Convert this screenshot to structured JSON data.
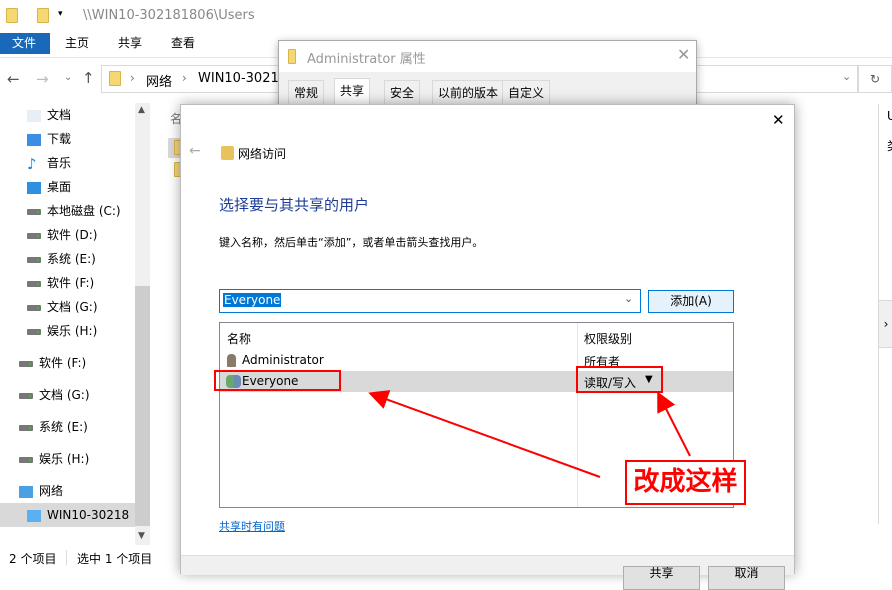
{
  "explorer": {
    "title": "\\\\WIN10-302181806\\Users",
    "ribbon_tabs": [
      "文件",
      "主页",
      "共享",
      "查看"
    ],
    "breadcrumb": [
      "网络",
      "WIN10-3021"
    ],
    "column_header_partial": "名",
    "sidebar": [
      {
        "label": "文档",
        "icon": "document-icon"
      },
      {
        "label": "下载",
        "icon": "download-icon"
      },
      {
        "label": "音乐",
        "icon": "music-icon"
      },
      {
        "label": "桌面",
        "icon": "desktop-icon"
      },
      {
        "label": "本地磁盘 (C:)",
        "icon": "system-drive-icon"
      },
      {
        "label": "软件 (D:)",
        "icon": "drive-icon"
      },
      {
        "label": "系统 (E:)",
        "icon": "drive-icon"
      },
      {
        "label": "软件 (F:)",
        "icon": "drive-icon"
      },
      {
        "label": "文档 (G:)",
        "icon": "drive-icon"
      },
      {
        "label": "娱乐 (H:)",
        "icon": "drive-icon"
      },
      {
        "label": "软件 (F:)",
        "icon": "drive-icon"
      },
      {
        "label": "文档 (G:)",
        "icon": "drive-icon"
      },
      {
        "label": "系统 (E:)",
        "icon": "drive-icon"
      },
      {
        "label": "娱乐 (H:)",
        "icon": "drive-icon"
      },
      {
        "label": "网络",
        "icon": "network-icon"
      },
      {
        "label": "WIN10-30218",
        "icon": "computer-icon"
      }
    ],
    "status_items": "2 个项目",
    "status_selected": "选中 1 个项目",
    "details_partial": [
      "U",
      "类"
    ]
  },
  "properties": {
    "title": "Administrator 属性",
    "tabs": [
      "常规",
      "共享",
      "安全",
      "以前的版本",
      "自定义"
    ],
    "active_tab": "共享"
  },
  "wizard": {
    "title": "网络访问",
    "heading": "选择要与其共享的用户",
    "instruction": "键入名称，然后单击“添加”，或者单击箭头查找用户。",
    "input_value": "Everyone",
    "add_button": "添加(A)",
    "columns": [
      "名称",
      "权限级别"
    ],
    "rows": [
      {
        "name": "Administrator",
        "permission": "所有者",
        "selected": false
      },
      {
        "name": "Everyone",
        "permission": "读取/写入",
        "selected": true
      }
    ],
    "help_link": "共享时有问题",
    "share_button": "共享",
    "cancel_button": "取消"
  },
  "annotation": {
    "label": "改成这样",
    "color": "#ff0000"
  }
}
